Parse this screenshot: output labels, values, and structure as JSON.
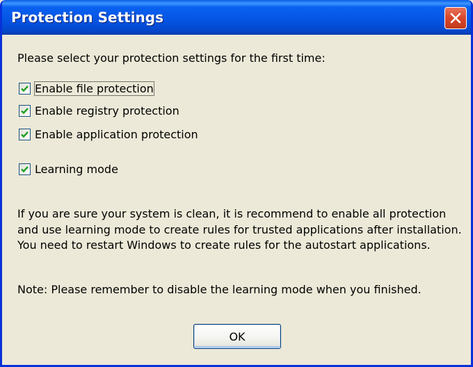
{
  "window": {
    "title": "Protection Settings"
  },
  "prompt": "Please select your protection settings for the first time:",
  "checkboxes": [
    {
      "label": "Enable file protection",
      "checked": true,
      "focused": true
    },
    {
      "label": "Enable registry protection",
      "checked": true
    },
    {
      "label": "Enable application protection",
      "checked": true
    },
    {
      "label": "Learning mode",
      "checked": true
    }
  ],
  "description": "If you are sure your system is clean, it is recommend to enable all protection and use learning mode to create rules for trusted applications after installation. You need to restart Windows to create rules for the autostart applications.",
  "note": "Note: Please remember to disable the learning mode when you finished.",
  "buttons": {
    "ok": "OK"
  },
  "icons": {
    "close": "close-icon",
    "check": "check-mark-icon"
  },
  "colors": {
    "titlebar": "#0553e3",
    "close": "#d8462a",
    "check": "#21a121",
    "background": "#ece9d8"
  }
}
